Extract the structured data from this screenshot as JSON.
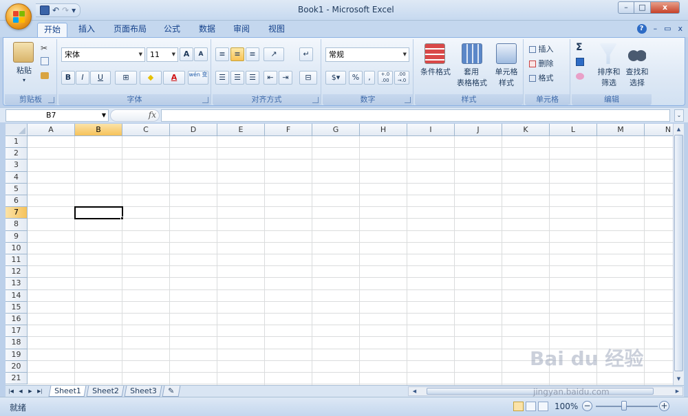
{
  "window": {
    "title": "Book1 - Microsoft Excel",
    "min": "–",
    "max": "□",
    "close": "x"
  },
  "qat": {
    "save_icon": "save-icon",
    "undo": "↶",
    "redo": "↷",
    "more": "▾"
  },
  "tabs": [
    {
      "label": "开始",
      "active": true
    },
    {
      "label": "插入"
    },
    {
      "label": "页面布局"
    },
    {
      "label": "公式"
    },
    {
      "label": "数据"
    },
    {
      "label": "审阅"
    },
    {
      "label": "视图"
    }
  ],
  "tabs_right": {
    "help": "?",
    "min": "–",
    "restore": "▭",
    "close": "x"
  },
  "ribbon": {
    "clipboard": {
      "label": "剪贴板",
      "paste": "粘贴",
      "paste_arrow": "▾"
    },
    "font": {
      "label": "字体",
      "name": "宋体",
      "size": "11",
      "grow": "A",
      "shrink": "A",
      "bold": "B",
      "italic": "I",
      "underline": "U",
      "border": "⊞",
      "fill": "◆",
      "color": "A",
      "phonetic": "wén 变"
    },
    "alignment": {
      "label": "对齐方式"
    },
    "number": {
      "label": "数字",
      "format": "常规",
      "percent": "%",
      "comma": ",",
      "inc_decimal": "+.0 .00",
      "dec_decimal": ".00 →.0"
    },
    "styles": {
      "label": "样式",
      "conditional_line1": "条件格式",
      "table_line1": "套用",
      "table_line2": "表格格式",
      "cell_line1": "单元格",
      "cell_line2": "样式"
    },
    "cells": {
      "label": "单元格",
      "insert": "插入",
      "delete": "删除",
      "format": "格式"
    },
    "editing": {
      "label": "编辑",
      "sum": "Σ",
      "sort_line1": "排序和",
      "sort_line2": "筛选",
      "find_line1": "查找和",
      "find_line2": "选择"
    }
  },
  "formula_bar": {
    "name_box": "B7",
    "fx": "fx",
    "value": ""
  },
  "grid": {
    "columns": [
      "A",
      "B",
      "C",
      "D",
      "E",
      "F",
      "G",
      "H",
      "I",
      "J",
      "K",
      "L",
      "M",
      "N"
    ],
    "rows": [
      "1",
      "2",
      "3",
      "4",
      "5",
      "6",
      "7",
      "8",
      "9",
      "10",
      "11",
      "12",
      "13",
      "14",
      "15",
      "16",
      "17",
      "18",
      "19",
      "20",
      "21"
    ],
    "selected_column": "B",
    "selected_row": "7"
  },
  "sheets": [
    {
      "label": "Sheet1",
      "active": true
    },
    {
      "label": "Sheet2"
    },
    {
      "label": "Sheet3"
    }
  ],
  "status": {
    "text": "就绪",
    "zoom": "100%"
  },
  "watermark": {
    "brand": "Bai du 经验",
    "url": "jingyan.baidu.com"
  },
  "colors": {
    "accent": "#15428b",
    "ribbon_bg": "#dde8f5",
    "selected_header": "#f6c25a"
  }
}
